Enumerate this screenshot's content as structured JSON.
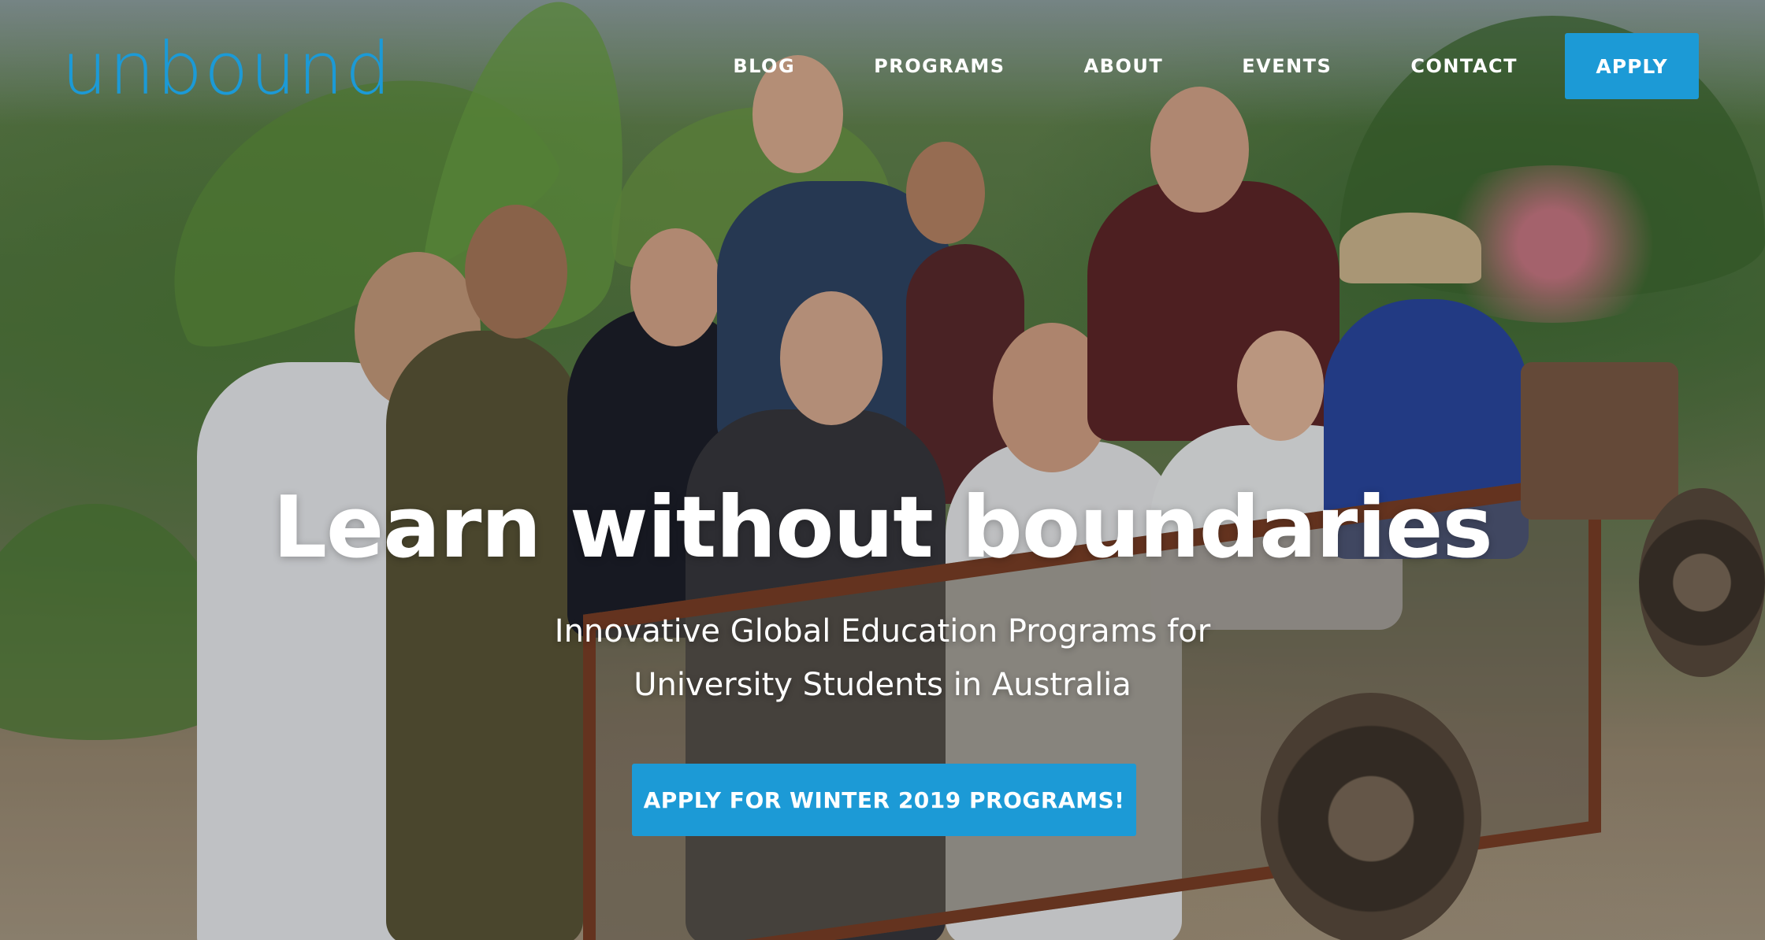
{
  "brand": {
    "logo_text": "unbound",
    "accent_color": "#1c9ad6"
  },
  "nav": {
    "links": [
      {
        "label": "BLOG"
      },
      {
        "label": "PROGRAMS"
      },
      {
        "label": "ABOUT"
      },
      {
        "label": "EVENTS"
      },
      {
        "label": "CONTACT"
      }
    ],
    "apply_label": "APPLY"
  },
  "hero": {
    "headline": "Learn without boundaries",
    "subheadline_line1": "Innovative Global Education Programs for",
    "subheadline_line2": "University Students in Australia",
    "cta_label": "APPLY FOR WINTER 2019 PROGRAMS!"
  }
}
